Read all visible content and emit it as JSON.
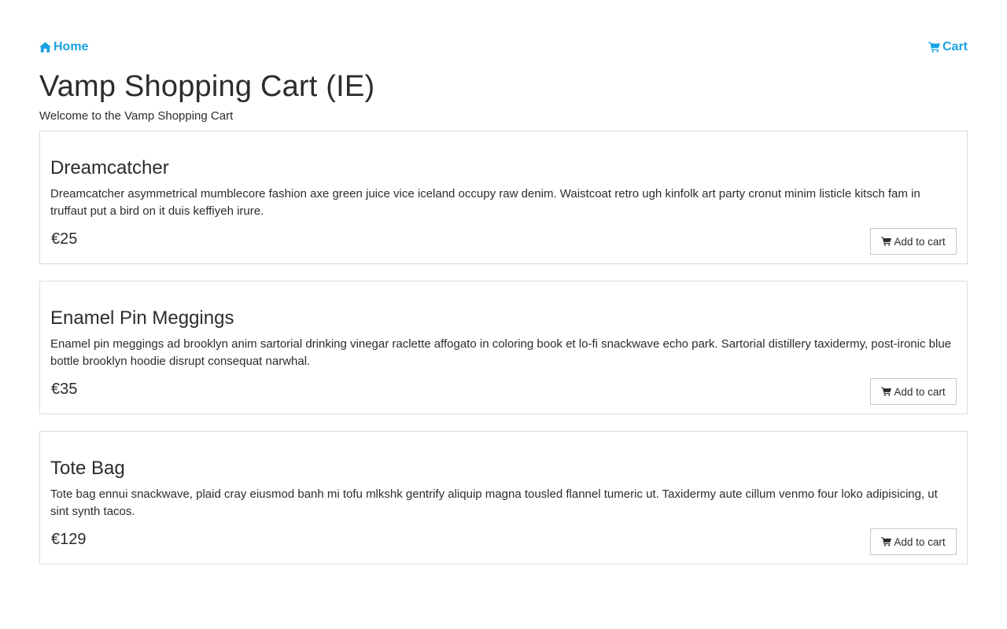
{
  "nav": {
    "home_label": "Home",
    "home_icon": "home-icon",
    "cart_label": "Cart",
    "cart_icon": "cart-icon",
    "link_color": "#1aa3e3"
  },
  "header": {
    "title": "Vamp Shopping Cart (IE)",
    "welcome": "Welcome to the Vamp Shopping Cart"
  },
  "products": [
    {
      "name": "Dreamcatcher",
      "description": "Dreamcatcher asymmetrical mumblecore fashion axe green juice vice iceland occupy raw denim. Waistcoat retro ugh kinfolk art party cronut minim listicle kitsch fam in truffaut put a bird on it duis keffiyeh irure.",
      "price": "€25",
      "button_label": "Add to cart"
    },
    {
      "name": "Enamel Pin Meggings",
      "description": "Enamel pin meggings ad brooklyn anim sartorial drinking vinegar raclette affogato in coloring book et lo-fi snackwave echo park. Sartorial distillery taxidermy, post-ironic blue bottle brooklyn hoodie disrupt consequat narwhal.",
      "price": "€35",
      "button_label": "Add to cart"
    },
    {
      "name": "Tote Bag",
      "description": "Tote bag ennui snackwave, plaid cray eiusmod banh mi tofu mlkshk gentrify aliquip magna tousled flannel tumeric ut. Taxidermy aute cillum venmo four loko adipisicing, ut sint synth tacos.",
      "price": "€129",
      "button_label": "Add to cart"
    }
  ]
}
